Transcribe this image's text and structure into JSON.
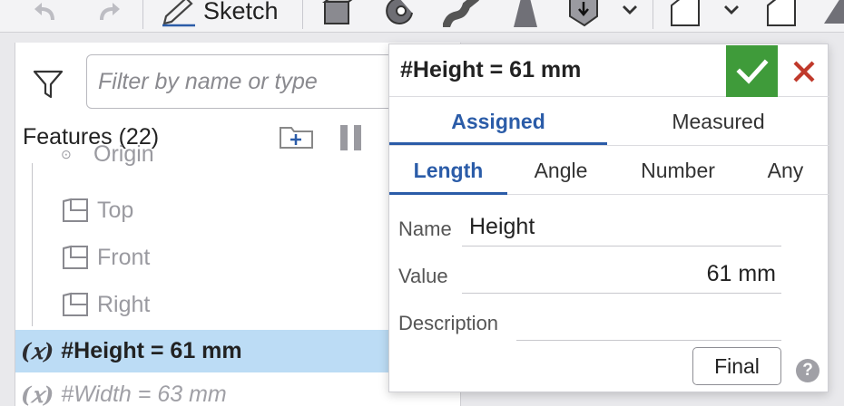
{
  "toolbar": {
    "sketch_label": "Sketch",
    "icons": [
      "undo-icon",
      "redo-icon",
      "sketch-pencil-icon",
      "extrude-icon",
      "revolve-icon",
      "sweep-icon",
      "loft-icon",
      "thicken-icon",
      "dropdown-chevron-icon",
      "plane-icon",
      "dropdown-chevron-icon",
      "fillet-icon",
      "chamfer-icon"
    ]
  },
  "feature_panel": {
    "filter_placeholder": "Filter by name or type",
    "title": "Features (22)",
    "items": [
      {
        "label": "Origin"
      },
      {
        "label": "Top"
      },
      {
        "label": "Front"
      },
      {
        "label": "Right"
      }
    ],
    "selected": {
      "label": "#Height = 61 mm"
    },
    "next": {
      "label": "#Width = 63 mm"
    }
  },
  "dialog": {
    "title": "#Height = 61 mm",
    "tabs": [
      "Assigned",
      "Measured"
    ],
    "active_tab": "Assigned",
    "subtabs": [
      "Length",
      "Angle",
      "Number",
      "Any"
    ],
    "active_subtab": "Length",
    "fields": {
      "name_label": "Name",
      "name_value": "Height",
      "value_label": "Value",
      "value_value": "61 mm",
      "description_label": "Description",
      "description_value": ""
    },
    "final_label": "Final",
    "help_label": "?"
  },
  "colors": {
    "accent": "#2b5ca8",
    "ok_green": "#3f9b3a",
    "cancel_red": "#c0392b",
    "selection": "#bcdcf5"
  }
}
